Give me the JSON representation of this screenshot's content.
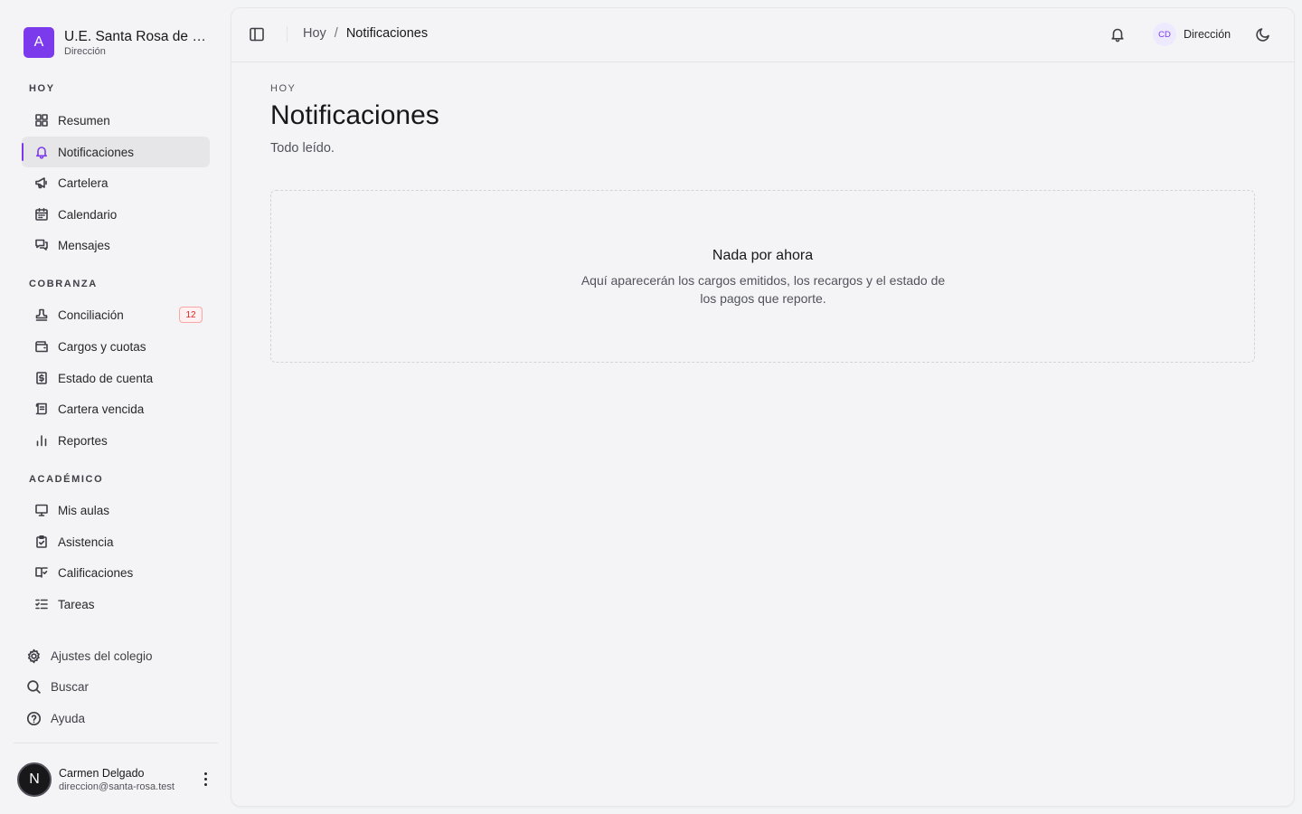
{
  "brand": {
    "logo_letter": "A",
    "name": "U.E. Santa Rosa de Lima",
    "role": "Dirección",
    "accent_color": "#7c3aed"
  },
  "sidebar": {
    "sections": [
      {
        "label": "HOY",
        "items": [
          {
            "label": "Resumen",
            "icon": "grid-icon"
          },
          {
            "label": "Notificaciones",
            "icon": "bell-icon",
            "active": true
          },
          {
            "label": "Cartelera",
            "icon": "megaphone-icon"
          },
          {
            "label": "Calendario",
            "icon": "calendar-icon"
          },
          {
            "label": "Mensajes",
            "icon": "chat-icon"
          }
        ]
      },
      {
        "label": "COBRANZA",
        "items": [
          {
            "label": "Conciliación",
            "icon": "stamp-icon",
            "badge": "12"
          },
          {
            "label": "Cargos y cuotas",
            "icon": "wallet-icon"
          },
          {
            "label": "Estado de cuenta",
            "icon": "receipt-dollar-icon"
          },
          {
            "label": "Cartera vencida",
            "icon": "scroll-icon"
          },
          {
            "label": "Reportes",
            "icon": "bar-chart-icon"
          }
        ]
      },
      {
        "label": "ACADÉMICO",
        "items": [
          {
            "label": "Mis aulas",
            "icon": "presentation-icon"
          },
          {
            "label": "Asistencia",
            "icon": "clipboard-check-icon"
          },
          {
            "label": "Calificaciones",
            "icon": "book-check-icon"
          },
          {
            "label": "Tareas",
            "icon": "list-todo-icon"
          }
        ]
      }
    ],
    "footer": [
      {
        "label": "Ajustes del colegio",
        "icon": "gear-icon"
      },
      {
        "label": "Buscar",
        "icon": "search-icon"
      },
      {
        "label": "Ayuda",
        "icon": "help-circle-icon"
      }
    ],
    "user": {
      "initial": "N",
      "name": "Carmen Delgado",
      "email": "direccion@santa-rosa.test"
    }
  },
  "header": {
    "breadcrumb": {
      "parent": "Hoy",
      "separator": "/",
      "current": "Notificaciones"
    },
    "user": {
      "initials": "CD",
      "name": "Dirección"
    }
  },
  "page": {
    "eyebrow": "HOY",
    "title": "Notificaciones",
    "subtitle": "Todo leído.",
    "empty": {
      "title": "Nada por ahora",
      "description": "Aquí aparecerán los cargos emitidos, los recargos y el estado de los pagos que reporte."
    }
  }
}
